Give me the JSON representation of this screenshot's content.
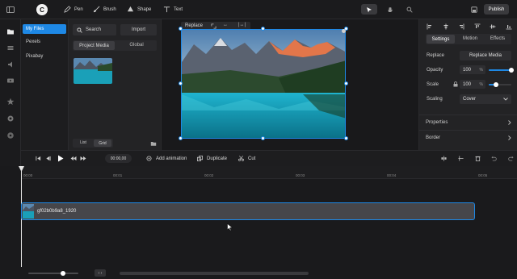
{
  "topbar": {
    "logo": "C",
    "tools": [
      {
        "label": "Pen",
        "icon": "pen-icon"
      },
      {
        "label": "Brush",
        "icon": "brush-icon"
      },
      {
        "label": "Shape",
        "icon": "shape-icon"
      },
      {
        "label": "Text",
        "icon": "text-icon"
      }
    ],
    "publish_label": "Publish"
  },
  "sources": {
    "items": [
      "My Files",
      "Pexels",
      "Pixabay"
    ],
    "active": "My Files"
  },
  "media": {
    "search_label": "Search",
    "import_label": "Import",
    "tabs": [
      "Project Media",
      "Global"
    ],
    "view_toggle": [
      "List",
      "Grid"
    ]
  },
  "canvas": {
    "replace_label": "Replace",
    "mini_tools": [
      "↔",
      "|↔|"
    ]
  },
  "right_panel": {
    "tabs": [
      "Settings",
      "Motion",
      "Effects"
    ],
    "replace_label": "Replace",
    "replace_button": "Replace Media",
    "opacity_label": "Opacity",
    "opacity_value": "100",
    "opacity_fraction": 1.0,
    "scale_label": "Scale",
    "scale_value": "100",
    "scale_fraction": 0.33,
    "percent": "%",
    "scaling_label": "Scaling",
    "scaling_value": "Cover",
    "sections": [
      "Properties",
      "Border"
    ]
  },
  "playbar": {
    "time": "00:00,00",
    "add_animation": "Add animation",
    "duplicate": "Duplicate",
    "cut": "Cut"
  },
  "timeline": {
    "ticks": [
      "00:00",
      "00:01",
      "00:02",
      "00:03",
      "00:04",
      "00:05"
    ],
    "clip_name": "gf02b0b9a8_1920",
    "zoom_label": "‹ ›",
    "zoom_fraction": 0.7
  },
  "colors": {
    "accent": "#1e88e5",
    "background": "#1d1d1f"
  }
}
